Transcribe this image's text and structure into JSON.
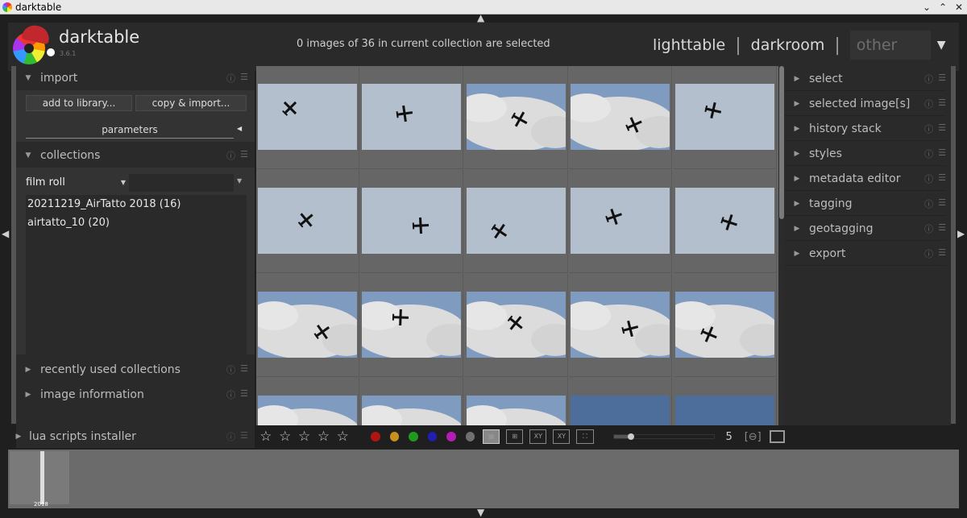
{
  "window": {
    "title": "darktable",
    "buttons": [
      "⌄",
      "⌃",
      "✕"
    ]
  },
  "header": {
    "brand": "darktable",
    "version": "3.6.1",
    "selection_status": "0 images of 36 in current collection are selected",
    "views": {
      "lighttable": "lighttable",
      "darkroom": "darkroom",
      "other": "other"
    }
  },
  "left_panel": {
    "import": {
      "title": "import",
      "add_button": "add to library...",
      "copy_button": "copy & import...",
      "parameters": "parameters"
    },
    "collections": {
      "title": "collections",
      "property": "film roll",
      "items": [
        "20211219_AirTatto 2018 (16)",
        "airtatto_10 (20)"
      ]
    },
    "recent": {
      "title": "recently used collections"
    },
    "image_info": {
      "title": "image information"
    },
    "lua": {
      "title": "lua scripts installer"
    }
  },
  "right_panel": {
    "modules": [
      "select",
      "selected image[s]",
      "history stack",
      "styles",
      "metadata editor",
      "tagging",
      "geotagging",
      "export"
    ]
  },
  "toolbar": {
    "stars": [
      "☆",
      "☆",
      "☆",
      "☆",
      "☆"
    ],
    "color_labels": [
      "#b01515",
      "#c8901f",
      "#1f9a1f",
      "#1f1fb0",
      "#b01fb0",
      "#707070"
    ],
    "zoom_value": "5",
    "zoom_fraction": 0.17
  },
  "filmstrip": {
    "year": "2018"
  },
  "grid": {
    "cols": 5,
    "rows": 4,
    "thumbs": [
      {
        "sky": "plain",
        "planes": 1
      },
      {
        "sky": "plain",
        "planes": 1
      },
      {
        "sky": "cloud",
        "planes": 1
      },
      {
        "sky": "cloud",
        "planes": 1
      },
      {
        "sky": "plain",
        "planes": 1
      },
      {
        "sky": "plain",
        "planes": 1
      },
      {
        "sky": "plain",
        "planes": 1
      },
      {
        "sky": "plain",
        "planes": 1
      },
      {
        "sky": "plain",
        "planes": 1
      },
      {
        "sky": "plain",
        "planes": 1
      },
      {
        "sky": "cloud",
        "planes": 1
      },
      {
        "sky": "cloud",
        "planes": 1
      },
      {
        "sky": "cloud",
        "planes": 1
      },
      {
        "sky": "cloud",
        "planes": 1
      },
      {
        "sky": "cloud",
        "planes": 1
      },
      {
        "sky": "cloud",
        "planes": 0
      },
      {
        "sky": "cloud",
        "planes": 0
      },
      {
        "sky": "cloud",
        "planes": 0
      },
      {
        "sky": "blue",
        "planes": 0
      },
      {
        "sky": "blue",
        "planes": 0
      }
    ]
  }
}
